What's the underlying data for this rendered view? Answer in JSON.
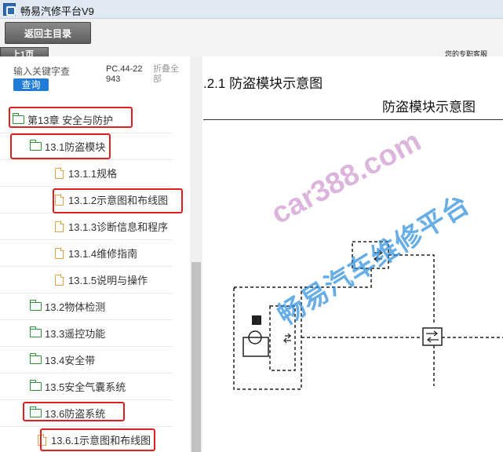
{
  "window": {
    "title": "畅易汽修平台V9"
  },
  "toolbar": {
    "back_label": "返回主目录",
    "prev_label": "上1页",
    "agent_label": "您的专职客服"
  },
  "search": {
    "placeholder": "输入关键字查",
    "button_label": "查询",
    "doc_code": "PC.44-22943",
    "collapse_label": "折叠全部"
  },
  "tree": {
    "items": [
      {
        "label": "第13章 安全与防护",
        "type": "folder",
        "highlight": true
      },
      {
        "label": "13.1防盗模块",
        "type": "folder",
        "highlight": true
      },
      {
        "label": "13.1.1规格",
        "type": "doc",
        "highlight": false
      },
      {
        "label": "13.1.2示意图和布线图",
        "type": "doc",
        "highlight": true
      },
      {
        "label": "13.1.3诊断信息和程序",
        "type": "doc",
        "highlight": false
      },
      {
        "label": "13.1.4维修指南",
        "type": "doc",
        "highlight": false
      },
      {
        "label": "13.1.5说明与操作",
        "type": "doc",
        "highlight": false
      },
      {
        "label": "13.2物体检测",
        "type": "folder",
        "highlight": false
      },
      {
        "label": "13.3遥控功能",
        "type": "folder",
        "highlight": false
      },
      {
        "label": "13.4安全带",
        "type": "folder",
        "highlight": false
      },
      {
        "label": "13.5安全气囊系统",
        "type": "folder",
        "highlight": false
      },
      {
        "label": "13.6防盗系统",
        "type": "folder",
        "highlight": true
      },
      {
        "label": "13.6.1示意图和布线图",
        "type": "doc",
        "highlight": true
      }
    ]
  },
  "main": {
    "section_heading": ".2.1 防盗模块示意图",
    "figure_title": "防盗模块示意图"
  },
  "watermark": {
    "site": "car388.com",
    "name": "畅易汽车维修平台"
  },
  "colors": {
    "highlight": "#e02020",
    "folder": "#2f8f35",
    "doc": "#e0a34a",
    "accent": "#1e7cd6"
  }
}
